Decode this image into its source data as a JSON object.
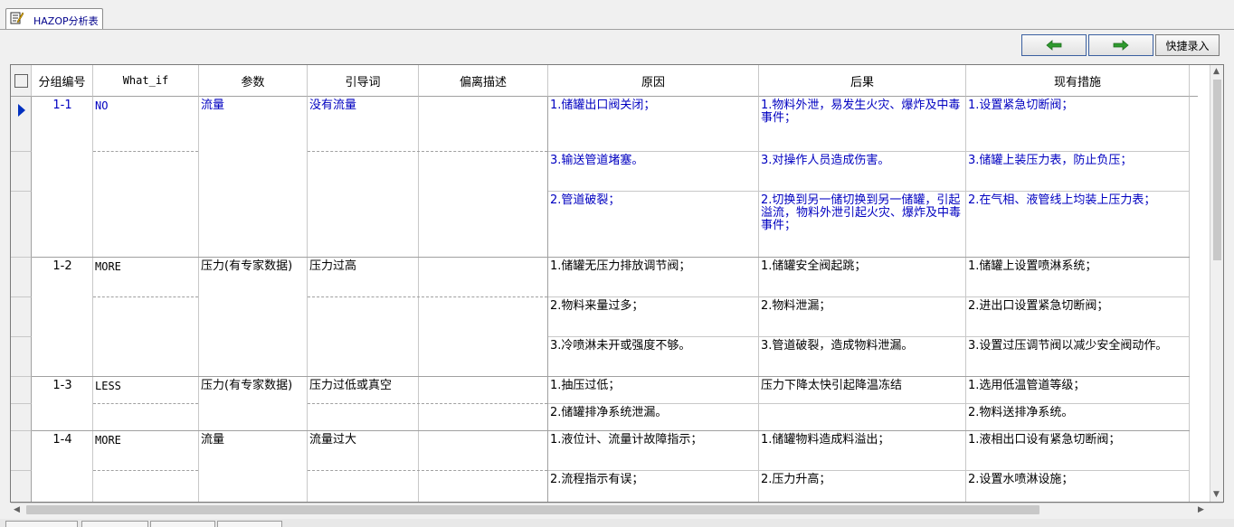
{
  "tab": {
    "title": "HAZOP分析表"
  },
  "toolbar": {
    "prev_icon": "arrow-left-icon",
    "next_icon": "arrow-right-icon",
    "quick_entry": "快捷录入"
  },
  "colors": {
    "selected_text": "#0000c0",
    "arrow_green": "#2e9a2e"
  },
  "columns": [
    "分组编号",
    "What_if",
    "参数",
    "引导词",
    "偏离描述",
    "原因",
    "后果",
    "现有措施"
  ],
  "groups": [
    {
      "id": "1-1",
      "whatif": "NO",
      "param": "流量",
      "guide": "没有流量",
      "rows": [
        {
          "cause": "1.储罐出口阀关闭；",
          "consequence": "1.物料外泄，易发生火灾、爆炸及中毒事件；",
          "measure": "1.设置紧急切断阀；"
        },
        {
          "cause": "3.输送管道堵塞。",
          "consequence": "3.对操作人员造成伤害。",
          "measure": "3.储罐上装压力表，防止负压；"
        },
        {
          "cause": "2.管道破裂；",
          "consequence": "2.切换到另一储切换到另一储罐，引起溢流，物料外泄引起火灾、爆炸及中毒事件；",
          "measure": "2.在气相、液管线上均装上压力表；"
        }
      ]
    },
    {
      "id": "1-2",
      "whatif": "MORE",
      "param": "压力(有专家数据)",
      "guide": "压力过高",
      "rows": [
        {
          "cause": "1.储罐无压力排放调节阀；",
          "consequence": "1.储罐安全阀起跳；",
          "measure": "1.储罐上设置喷淋系统；"
        },
        {
          "cause": "2.物料来量过多；",
          "consequence": "2.物料泄漏；",
          "measure": "2.进出口设置紧急切断阀；"
        },
        {
          "cause": "3.冷喷淋未开或强度不够。",
          "consequence": "3.管道破裂，造成物料泄漏。",
          "measure": "3.设置过压调节阀以减少安全阀动作。"
        }
      ]
    },
    {
      "id": "1-3",
      "whatif": "LESS",
      "param": "压力(有专家数据)",
      "guide": "压力过低或真空",
      "rows": [
        {
          "cause": "1.抽压过低；",
          "consequence": "压力下降太快引起降温冻结",
          "measure": "1.选用低温管道等级；"
        },
        {
          "cause": "2.储罐排净系统泄漏。",
          "consequence": "",
          "measure": "2.物料送排净系统。"
        }
      ]
    },
    {
      "id": "1-4",
      "whatif": "MORE",
      "param": "流量",
      "guide": "流量过大",
      "rows": [
        {
          "cause": "1.液位计、流量计故障指示；",
          "consequence": "1.储罐物料造成料溢出；",
          "measure": "1.液相出口设有紧急切断阀；"
        },
        {
          "cause": "2.流程指示有误；",
          "consequence": "2.压力升高；",
          "measure": "2.设置水喷淋设施；"
        }
      ]
    }
  ]
}
